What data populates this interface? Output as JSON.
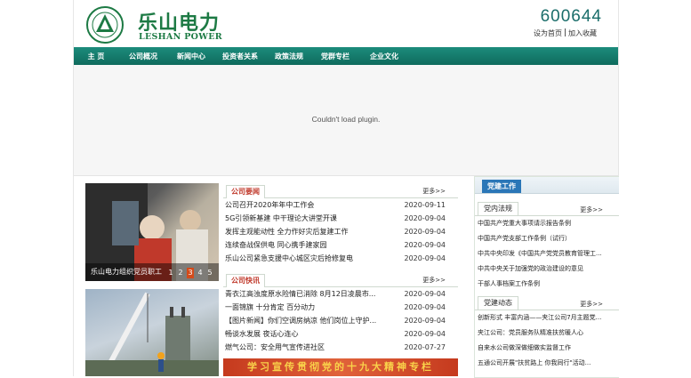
{
  "header": {
    "brand_cn": "乐山电力",
    "brand_en": "LESHAN POWER",
    "stock_code": "600644",
    "set_home": "设为首页",
    "add_favorite": "加入收藏"
  },
  "nav": [
    "主 页",
    "公司概况",
    "新闻中心",
    "投资者关系",
    "政策法规",
    "党群专栏",
    "企业文化"
  ],
  "plugin": {
    "message": "Couldn't load plugin."
  },
  "slideshow": {
    "caption": "乐山电力组织党员职工",
    "pages": [
      "1",
      "2",
      "3",
      "4",
      "5"
    ],
    "active_page": "3"
  },
  "company_news": {
    "tab": "公司要闻",
    "more": "更多>>",
    "items": [
      {
        "title": "公司召开2020年年中工作会",
        "date": "2020-09-11"
      },
      {
        "title": "5G引领新基建 中干理论大讲堂开课",
        "date": "2020-09-04"
      },
      {
        "title": "发挥主观能动性 全力作好灾后复建工作",
        "date": "2020-09-04"
      },
      {
        "title": "连续奋战保供电 同心携手建家园",
        "date": "2020-09-04"
      },
      {
        "title": "乐山公司紧急支援中心城区灾后抢修复电",
        "date": "2020-09-04"
      }
    ]
  },
  "company_flash": {
    "tab": "公司快讯",
    "more": "更多>>",
    "items": [
      {
        "title": "青衣江高浊度原水险情已消除 8月12日凌晨市...",
        "date": "2020-09-04"
      },
      {
        "title": "一面锦旗 十分肯定 百分动力",
        "date": "2020-09-04"
      },
      {
        "title": "【图片新闻】你们空调房纳凉 他们岗位上守护...",
        "date": "2020-09-04"
      },
      {
        "title": "畅谈水发展 夜话心连心",
        "date": "2020-09-04"
      },
      {
        "title": "燃气公司：安全用气宣传进社区",
        "date": "2020-07-27"
      }
    ]
  },
  "banner": {
    "text": "学习宣传贯彻党的十九大精神专栏"
  },
  "party": {
    "tab": "党建工作",
    "regulations": {
      "tab": "党内法规",
      "more": "更多>>",
      "items": [
        "中国共产党重大事项请示报告条例",
        "中国共产党支部工作条例（试行）",
        "中共中央印发《中国共产党党员教育管理工...",
        "中共中央关于加强党的政治建设的意见",
        "干部人事档案工作条例"
      ]
    },
    "dynamics": {
      "tab": "党建动态",
      "more": "更多>>",
      "items": [
        "创新形式 丰富内涵——夹江公司7月主题党...",
        "夹江公司：党员服务队精准扶贫暖人心",
        "自来水公司做深做细做实监督工作",
        "五通公司开展\"扶贫路上 你我同行\"活动..."
      ]
    }
  },
  "colors": {
    "brand_green": "#1d7a44",
    "nav_teal": "#0f6b5d",
    "tab_red": "#c0392b",
    "party_blue": "#2a76b7"
  }
}
